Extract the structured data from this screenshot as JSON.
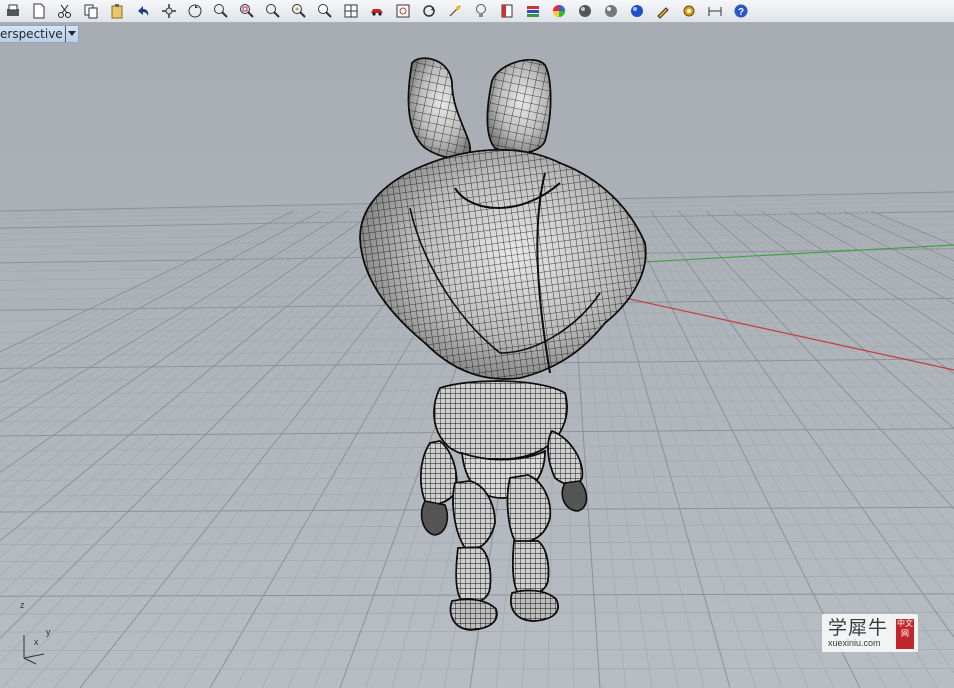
{
  "toolbar": {
    "icons": [
      "print-icon",
      "new-file-icon",
      "cut-icon",
      "copy-icon",
      "paste-icon",
      "undo-icon",
      "pan-icon",
      "rotate-view-icon",
      "zoom-icon",
      "zoom-window-icon",
      "zoom-extents-icon",
      "zoom-selected-icon",
      "select-icon",
      "grid-icon",
      "car-render-icon",
      "settings-sheet-icon",
      "circle-arrow-icon",
      "point-icon",
      "light-bulb-icon",
      "layer-icon",
      "material-stack-icon",
      "color-wheel-icon",
      "shade-sphere-icon",
      "ghost-sphere-icon",
      "render-sphere-icon",
      "pencil-icon",
      "gear-icon",
      "dimension-icon",
      "help-icon"
    ]
  },
  "viewport": {
    "name": "Perspective",
    "shown_label": "erspective"
  },
  "axis_widget": {
    "z": "z",
    "x": "x",
    "y": "y"
  },
  "watermark": {
    "main": "学犀牛",
    "url": "xuexiniu.com",
    "seal": "中文网"
  },
  "colors": {
    "background_top": "#a9aeb5",
    "background_floor": "#b9bec5",
    "grid_line": "#9aa0a8",
    "x_axis": "#c43c3c",
    "y_axis": "#3fa33f",
    "wire": "#111111"
  }
}
